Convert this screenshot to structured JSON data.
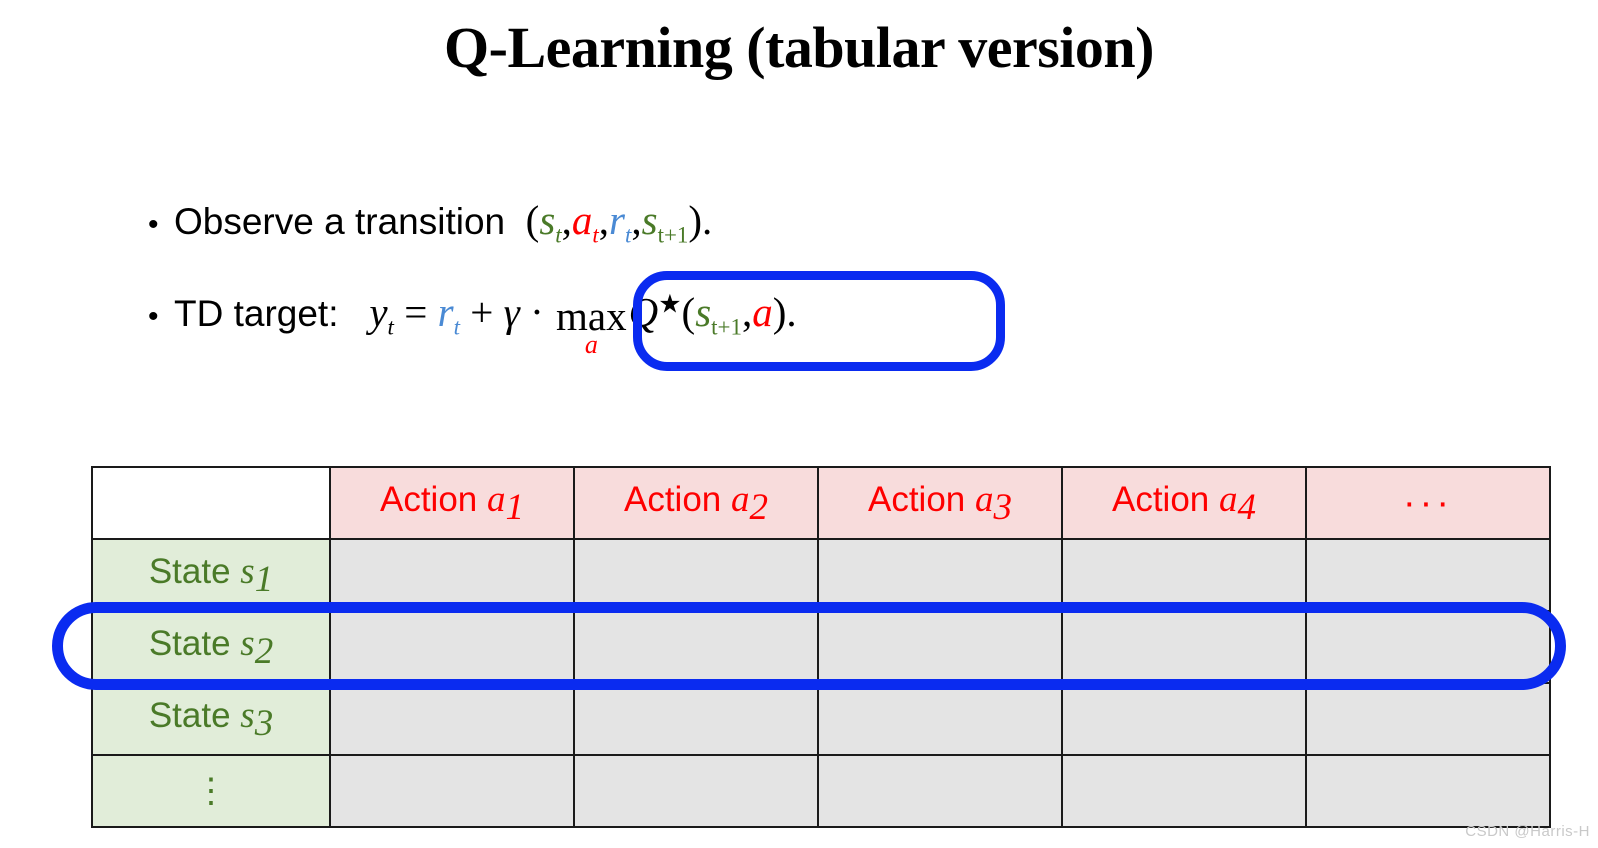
{
  "slide": {
    "title": "Q-Learning (tabular version)",
    "background": "#ffffff"
  },
  "colors": {
    "state_green": "#4a7a28",
    "action_red": "#fe0000",
    "reward_blue": "#4a8ad4",
    "annotation_blue": "#0a2bf0",
    "header_fill": "#f8dcdc",
    "state_fill": "#e1edd9",
    "body_fill": "#e4e4e4",
    "border": "#1a1a1a"
  },
  "bullets": [
    {
      "marker": "•",
      "lead": "Observe a transition",
      "formula_plain": "(s_t, a_t, r_t, s_{t+1}).",
      "tokens": {
        "open_paren": "(",
        "s": "s",
        "t": "t",
        "comma1": ",",
        "a": "a",
        "t2": "t",
        "comma2": ",",
        "r": "r",
        "t3": "t",
        "comma3": ",",
        "s2": "s",
        "tplus1": "t+1",
        "close_paren": ")",
        "period": "."
      }
    },
    {
      "marker": "•",
      "lead": "TD target:",
      "formula_plain": "y_t = r_t + γ · max_a Q★(s_{t+1}, a).",
      "tokens": {
        "y": "y",
        "y_sub": "t",
        "equals": "=",
        "r": "r",
        "r_sub": "t",
        "plus": "+",
        "gamma": "γ",
        "cdot": "·",
        "max": "max",
        "max_sub": "a",
        "Q": "Q",
        "star": "★",
        "open_paren": "(",
        "s": "s",
        "s_sub": "t+1",
        "comma": ",",
        "a": "a",
        "close_paren": ")",
        "period": "."
      }
    }
  ],
  "annotations": [
    {
      "name": "td-target-max-highlight",
      "shape": "rounded-rectangle",
      "color": "#0a2bf0",
      "targets": "max_a Q★(s_{t+1}, a)."
    },
    {
      "name": "state-s2-row-highlight",
      "shape": "ellipse",
      "color": "#0a2bf0",
      "targets": "State s₂ row"
    }
  ],
  "table": {
    "corner_label": "",
    "column_headers": [
      {
        "label": "Action",
        "symbol": "a",
        "subscript": "1"
      },
      {
        "label": "Action",
        "symbol": "a",
        "subscript": "2"
      },
      {
        "label": "Action",
        "symbol": "a",
        "subscript": "3"
      },
      {
        "label": "Action",
        "symbol": "a",
        "subscript": "4"
      },
      {
        "label": "···",
        "symbol": "",
        "subscript": ""
      }
    ],
    "rows": [
      {
        "label": "State",
        "symbol": "s",
        "subscript": "1",
        "cells": [
          "",
          "",
          "",
          "",
          ""
        ]
      },
      {
        "label": "State",
        "symbol": "s",
        "subscript": "2",
        "cells": [
          "",
          "",
          "",
          "",
          ""
        ]
      },
      {
        "label": "State",
        "symbol": "s",
        "subscript": "3",
        "cells": [
          "",
          "",
          "",
          "",
          ""
        ]
      },
      {
        "label": "⋮",
        "symbol": "",
        "subscript": "",
        "cells": [
          "",
          "",
          "",
          "",
          ""
        ]
      }
    ]
  },
  "watermark": "CSDN @Harris-H"
}
